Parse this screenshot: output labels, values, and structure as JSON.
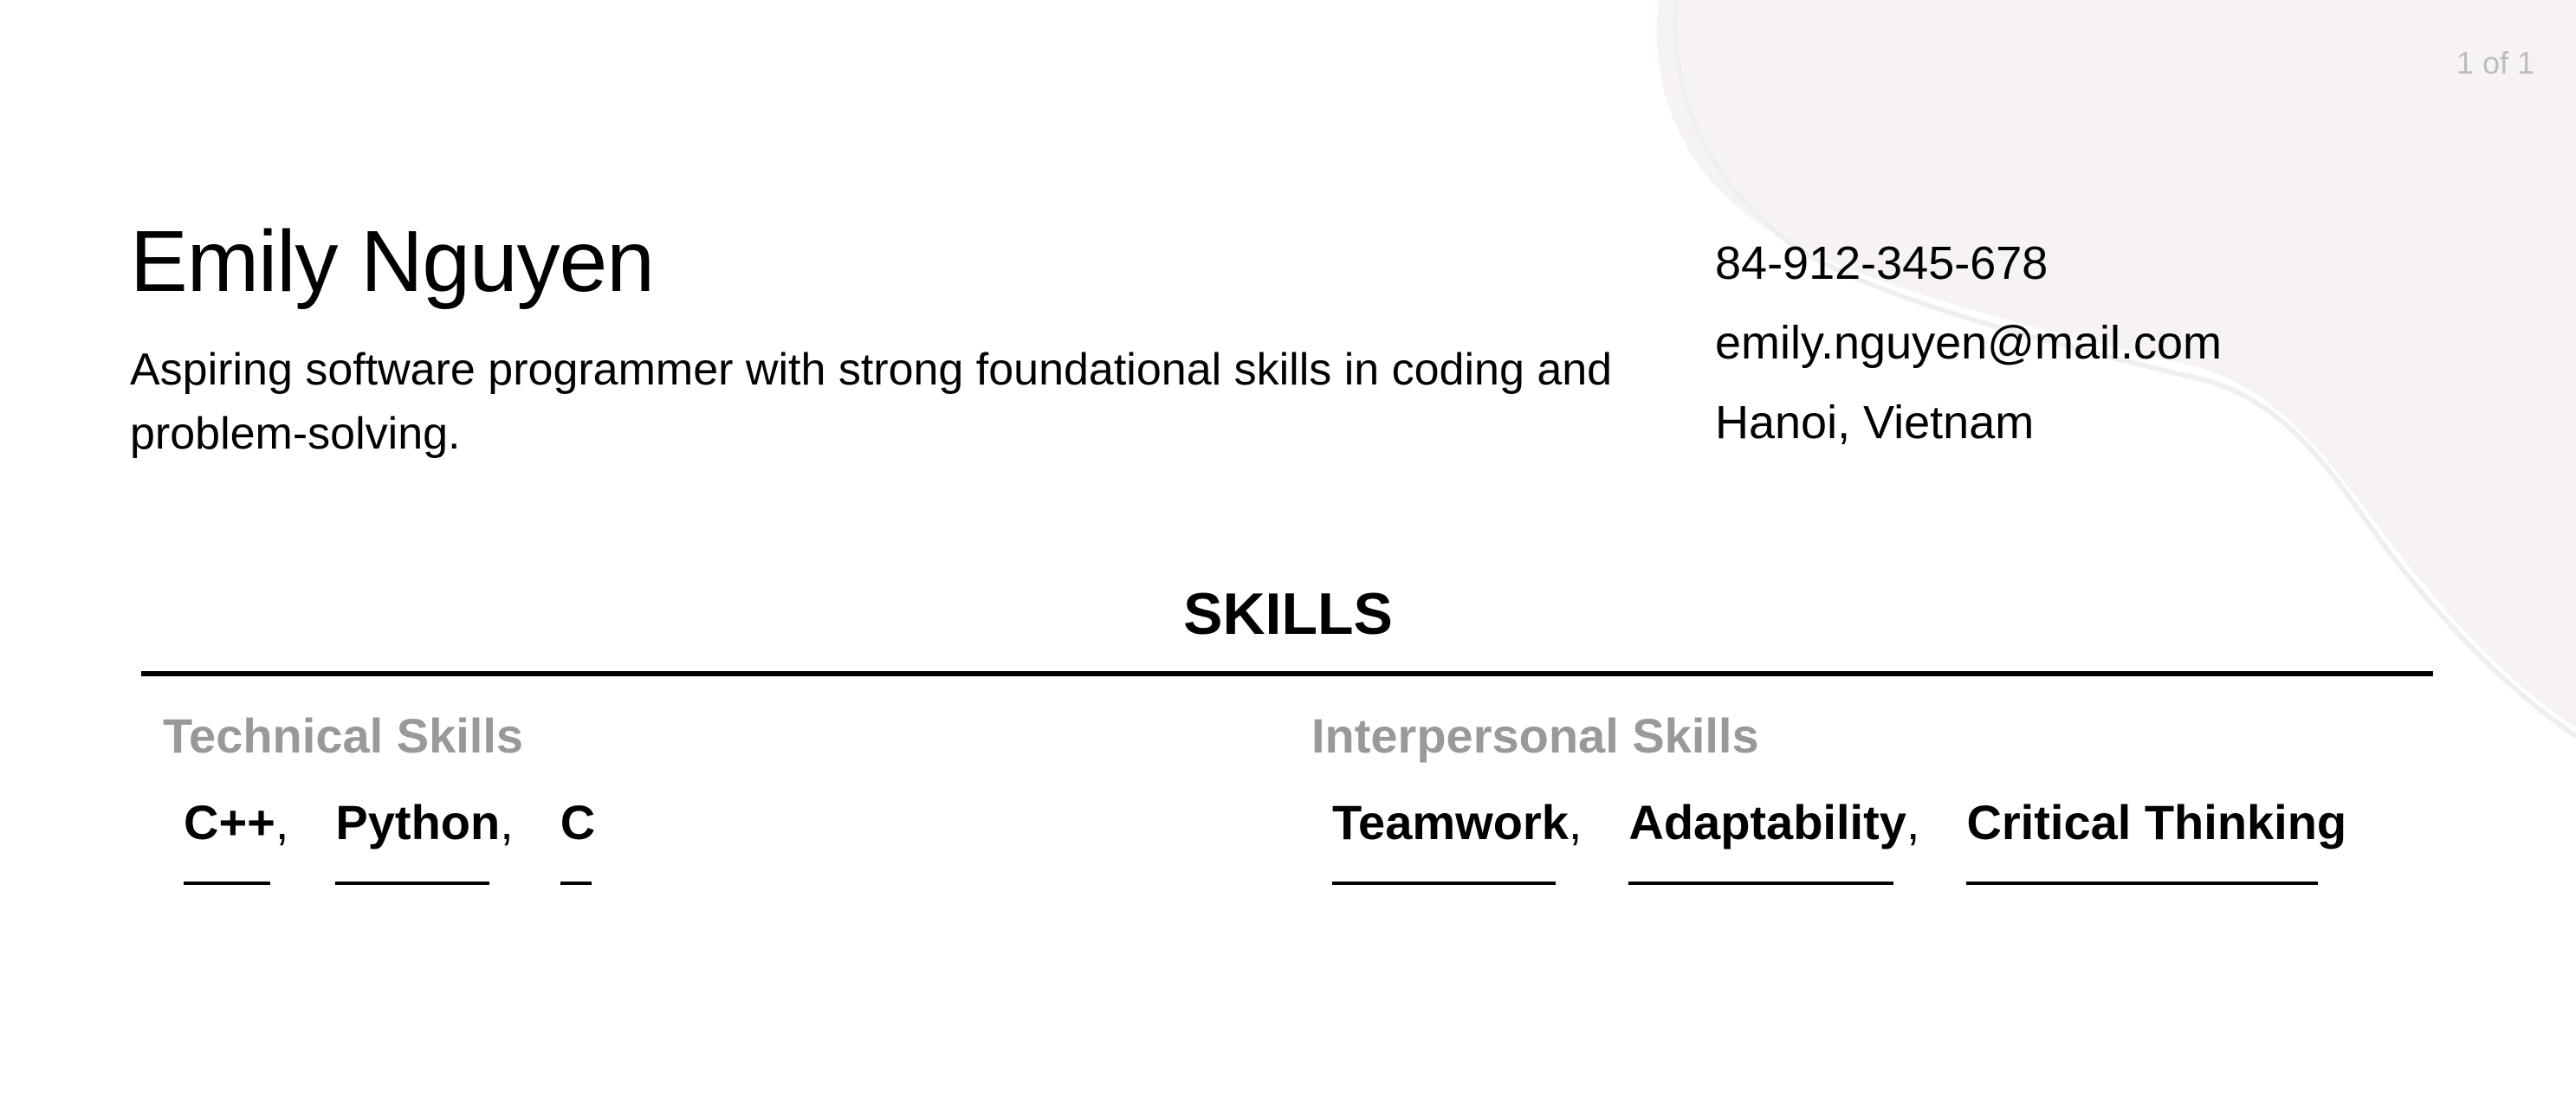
{
  "page": {
    "counter": "1 of 1"
  },
  "header": {
    "name": "Emily Nguyen",
    "summary": "Aspiring software programmer with strong foundational skills in coding and problem-solving.",
    "contact": {
      "phone": "84-912-345-678",
      "email": "emily.nguyen@mail.com",
      "location": "Hanoi, Vietnam"
    }
  },
  "skills": {
    "title": "SKILLS",
    "technical": {
      "title": "Technical Skills",
      "items": [
        "C++",
        "Python",
        "C"
      ]
    },
    "interpersonal": {
      "title": "Interpersonal Skills",
      "items": [
        "Teamwork",
        "Adaptability",
        "Critical Thinking"
      ]
    }
  },
  "colors": {
    "blob": "#f6f3f2",
    "subheading": "#999999",
    "counter": "#bdbdbd"
  }
}
